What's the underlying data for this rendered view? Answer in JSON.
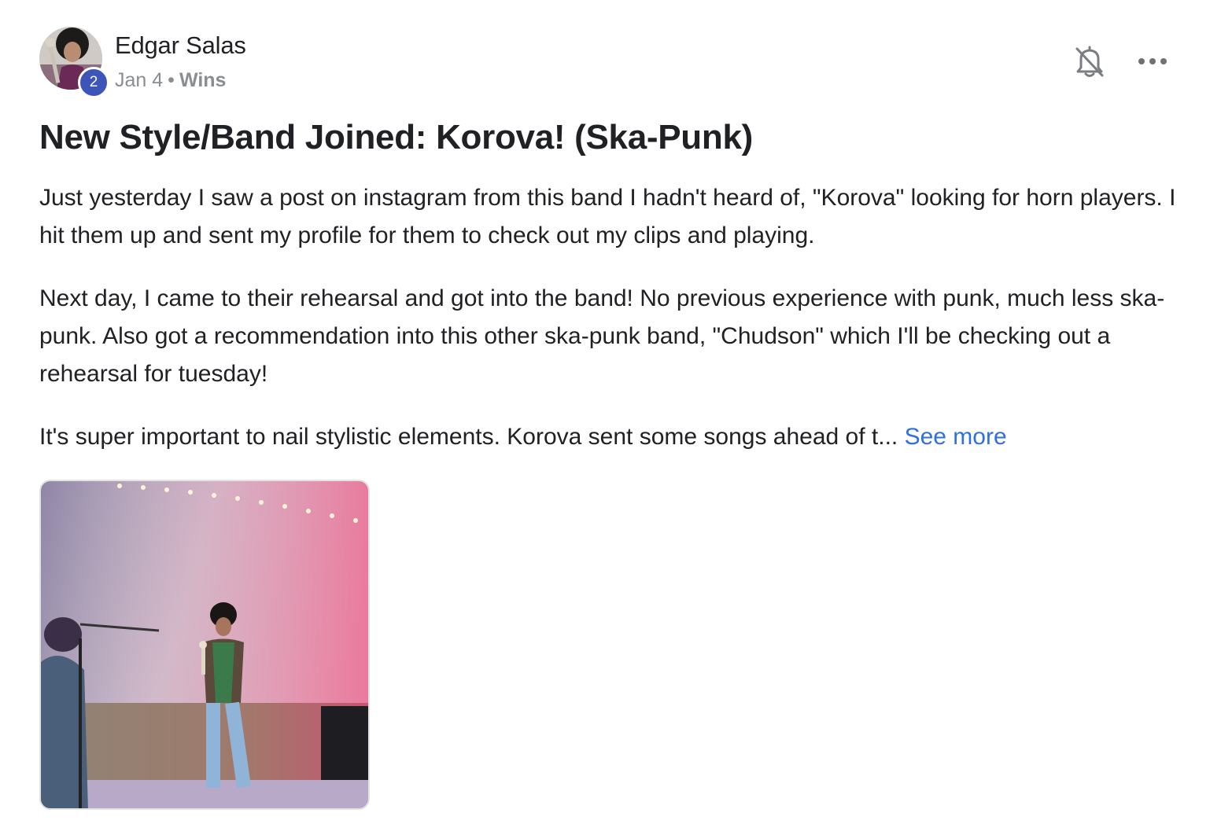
{
  "post": {
    "author": {
      "name": "Edgar Salas",
      "level": "2",
      "avatar_icon": "user-avatar-trumpet"
    },
    "meta": {
      "date": "Jan 4",
      "separator": "•",
      "category": "Wins"
    },
    "actions": {
      "notify_icon": "bell-off-icon",
      "more_icon": "more-horizontal-icon"
    },
    "title": "New Style/Band Joined: Korova! (Ska-Punk)",
    "paragraphs": [
      "Just yesterday I saw a post on instagram from this band I hadn't heard of, \"Korova\" looking for horn players. I hit them up and sent my profile for them to check out my clips and playing.",
      "Next day, I came to their rehearsal and got into the band! No previous experience with punk, much less ska-punk. Also got a recommendation into this other ska-punk band, \"Chudson\" which I'll be checking out a rehearsal for tuesday!",
      "It's super important to nail stylistic elements. Korova sent some songs ahead of t..."
    ],
    "see_more_label": "See more",
    "attachment": {
      "type": "image"
    }
  },
  "colors": {
    "badge": "#3d54b8",
    "link": "#2f6fe4",
    "meta": "#8a8d91",
    "text": "#202124"
  }
}
